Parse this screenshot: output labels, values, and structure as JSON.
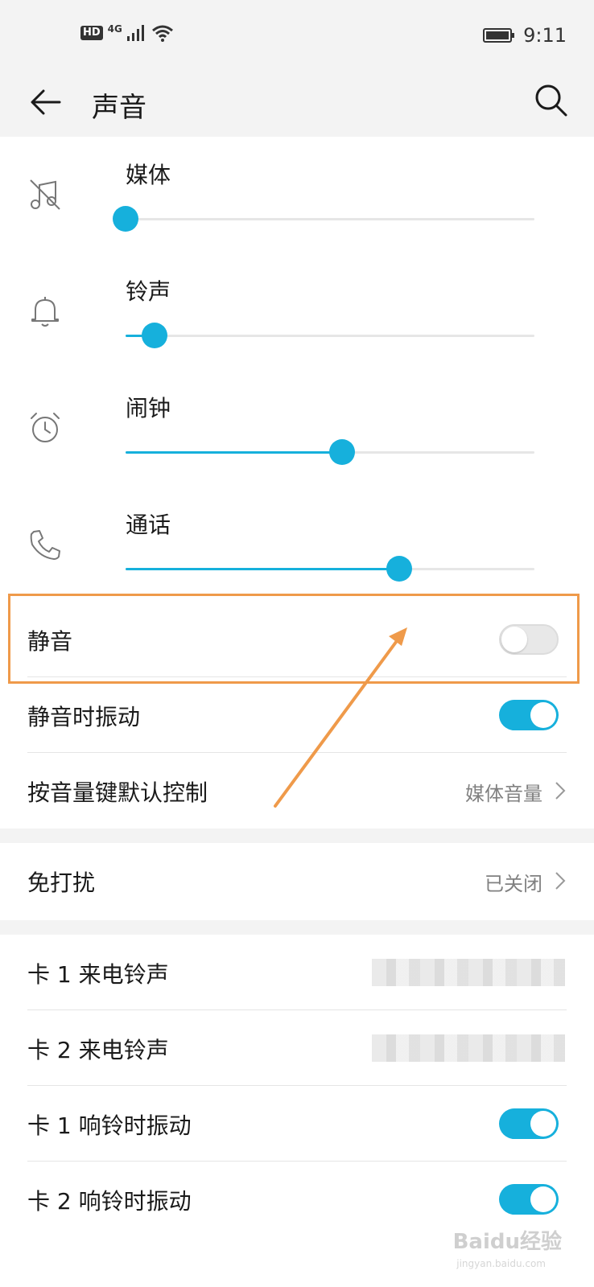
{
  "status_bar": {
    "hd_badge": "HD",
    "network": "4G",
    "time": "9:11"
  },
  "header": {
    "title": "声音",
    "back_icon": "arrow-left-icon",
    "search_icon": "search-icon"
  },
  "volume": {
    "media": {
      "label": "媒体",
      "level": 0.0,
      "icon": "music-muted-icon"
    },
    "ringtone": {
      "label": "铃声",
      "level": 0.07,
      "icon": "bell-icon"
    },
    "alarm": {
      "label": "闹钟",
      "level": 0.53,
      "icon": "alarm-clock-icon"
    },
    "call": {
      "label": "通话",
      "level": 0.67,
      "icon": "phone-icon"
    }
  },
  "settings": {
    "mute": {
      "label": "静音",
      "enabled": false
    },
    "vibrate_on_mute": {
      "label": "静音时振动",
      "enabled": true
    },
    "volume_key": {
      "label": "按音量键默认控制",
      "value": "媒体音量"
    },
    "dnd": {
      "label": "免打扰",
      "value": "已关闭"
    },
    "sim1_ringtone": {
      "label": "卡 1 来电铃声"
    },
    "sim2_ringtone": {
      "label": "卡 2 来电铃声"
    },
    "sim1_vibrate": {
      "label": "卡 1 响铃时振动",
      "enabled": true
    },
    "sim2_vibrate": {
      "label": "卡 2 响铃时振动",
      "enabled": true
    }
  },
  "colors": {
    "accent": "#16b0dc",
    "highlight": "#ef9a4a"
  },
  "watermark": {
    "brand": "Baidu经验",
    "url": "jingyan.baidu.com"
  }
}
